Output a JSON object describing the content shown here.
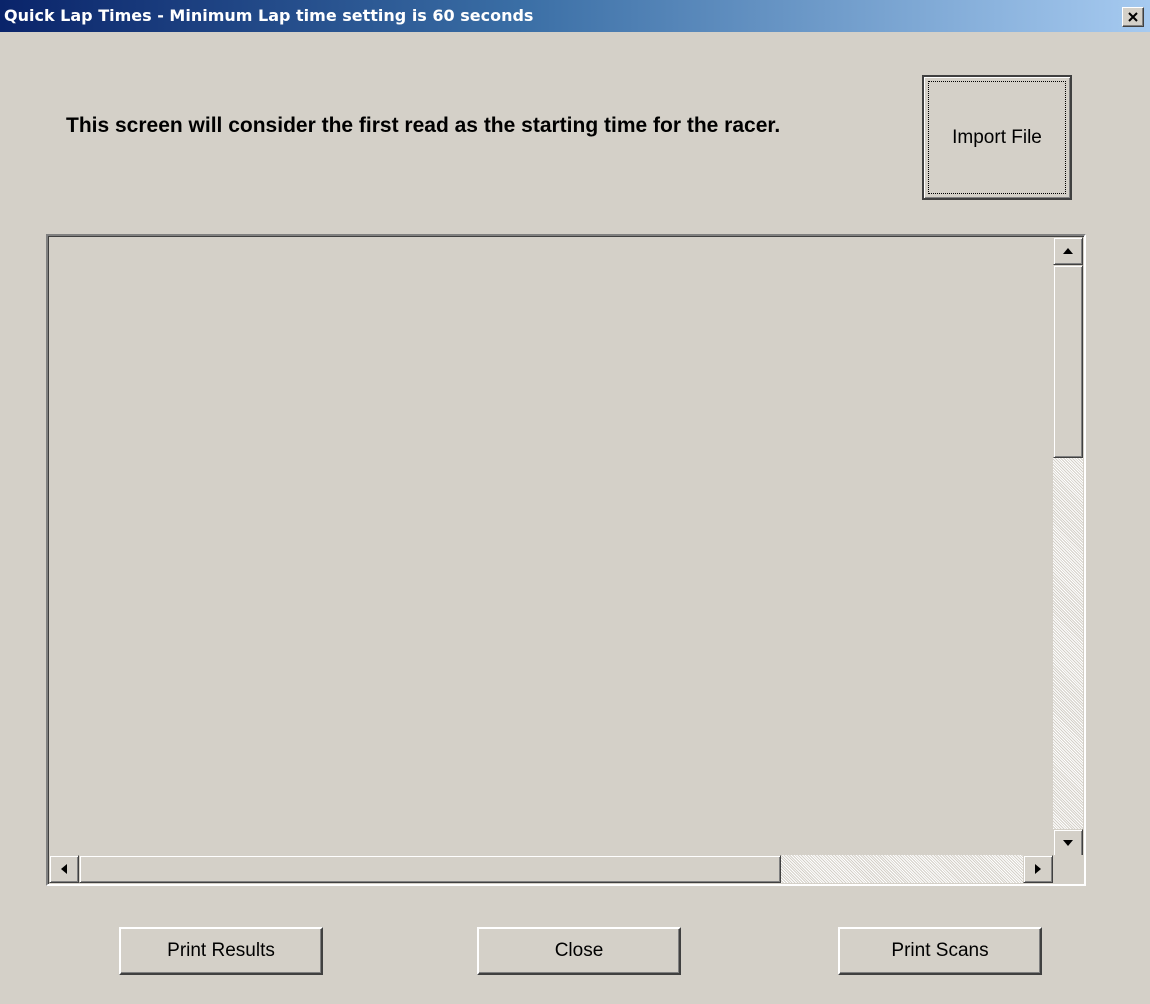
{
  "window": {
    "title": "Quick Lap Times - Minimum Lap time setting is 60 seconds",
    "close_icon": "close-icon"
  },
  "main": {
    "instruction": "This screen will consider the first read as the starting time for the racer.",
    "import_button_label": "Import File",
    "results_list": {
      "items": [],
      "vertical_scroll_position": 0,
      "horizontal_scroll_position": 0
    }
  },
  "footer": {
    "print_results_label": "Print Results",
    "close_label": "Close",
    "print_scans_label": "Print Scans"
  },
  "colors": {
    "face": "#d4d0c8",
    "title_start": "#0a246a",
    "title_end": "#a6caf0",
    "title_text": "#ffffff"
  }
}
